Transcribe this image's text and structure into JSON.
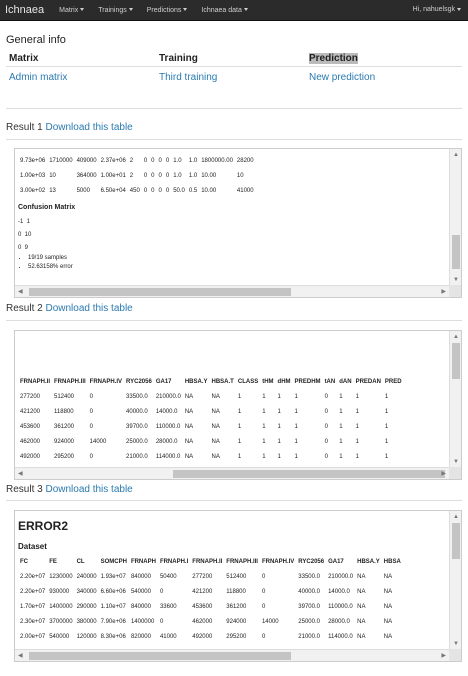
{
  "navbar": {
    "brand": "Ichnaea",
    "menus": [
      "Matrix",
      "Trainings",
      "Predictions",
      "Ichnaea data"
    ],
    "user": "Hi, nahuelsgk"
  },
  "general": {
    "title": "General info",
    "headers": [
      "Matrix",
      "Training",
      "Prediction"
    ],
    "links": [
      "Admin matrix",
      "Third training",
      "New prediction"
    ]
  },
  "results": [
    {
      "title": "Result 1",
      "link": "Download this table"
    },
    {
      "title": "Result 2",
      "link": "Download this table"
    },
    {
      "title": "Result 3",
      "link": "Download this table"
    }
  ],
  "result1": {
    "rows": [
      [
        "9.73e+06",
        "1710000",
        "409000",
        "2.37e+06",
        "2",
        "0",
        "0",
        "0",
        "0",
        "1.0",
        "1.0",
        "1800000.00",
        "28200"
      ],
      [
        "1.00e+03",
        "10",
        "364000",
        "1.00e+01",
        "2",
        "0",
        "0",
        "0",
        "0",
        "1.0",
        "1.0",
        "10.00",
        "10"
      ],
      [
        "3.00e+02",
        "13",
        "5000",
        "6.50e+04",
        "450",
        "0",
        "0",
        "0",
        "0",
        "50.0",
        "0.5",
        "10.00",
        "41000"
      ]
    ],
    "confusion_title": "Confusion Matrix",
    "confusion_lines": [
      "-1  1",
      "0  10",
      "0  9"
    ],
    "bullets": [
      "19/19 samples",
      "52.63158% error"
    ]
  },
  "result2": {
    "headers": [
      "FRNAPH.II",
      "FRNAPH.III",
      "FRNAPH.IV",
      "RYC2056",
      "GA17",
      "HBSA.Y",
      "HBSA.T",
      "CLASS",
      "tHM",
      "dHM",
      "PREDHM",
      "tAN",
      "dAN",
      "PREDAN",
      "PRED"
    ],
    "rows": [
      [
        "277200",
        "512400",
        "0",
        "33500.0",
        "210000.0",
        "NA",
        "NA",
        "1",
        "1",
        "1",
        "1",
        "0",
        "1",
        "1",
        "1"
      ],
      [
        "421200",
        "118800",
        "0",
        "40000.0",
        "14000.0",
        "NA",
        "NA",
        "1",
        "1",
        "1",
        "1",
        "0",
        "1",
        "1",
        "1"
      ],
      [
        "453600",
        "361200",
        "0",
        "39700.0",
        "110000.0",
        "NA",
        "NA",
        "1",
        "1",
        "1",
        "1",
        "0",
        "1",
        "1",
        "1"
      ],
      [
        "462000",
        "924000",
        "14000",
        "25000.0",
        "28000.0",
        "NA",
        "NA",
        "1",
        "1",
        "1",
        "1",
        "0",
        "1",
        "1",
        "1"
      ],
      [
        "492000",
        "295200",
        "0",
        "21000.0",
        "114000.0",
        "NA",
        "NA",
        "1",
        "1",
        "1",
        "1",
        "0",
        "1",
        "1",
        "1"
      ]
    ]
  },
  "result3": {
    "error_title": "ERROR2",
    "dataset_title": "Dataset",
    "headers": [
      "FC",
      "FE",
      "CL",
      "SOMCPH",
      "FRNAPH",
      "FRNAPH.I",
      "FRNAPH.II",
      "FRNAPH.III",
      "FRNAPH.IV",
      "RYC2056",
      "GA17",
      "HBSA.Y",
      "HBSA"
    ],
    "rows": [
      [
        "2.20e+07",
        "1230000",
        "240000",
        "1.93e+07",
        "840000",
        "50400",
        "277200",
        "512400",
        "0",
        "33500.0",
        "210000.0",
        "NA",
        "NA"
      ],
      [
        "2.20e+07",
        "930000",
        "340000",
        "6.60e+06",
        "540000",
        "0",
        "421200",
        "118800",
        "0",
        "40000.0",
        "14000.0",
        "NA",
        "NA"
      ],
      [
        "1.70e+07",
        "1400000",
        "290000",
        "1.10e+07",
        "840000",
        "33600",
        "453600",
        "361200",
        "0",
        "39700.0",
        "110000.0",
        "NA",
        "NA"
      ],
      [
        "2.30e+07",
        "3700000",
        "380000",
        "7.90e+06",
        "1400000",
        "0",
        "462000",
        "924000",
        "14000",
        "25000.0",
        "28000.0",
        "NA",
        "NA"
      ],
      [
        "2.00e+07",
        "540000",
        "120000",
        "8.30e+06",
        "820000",
        "41000",
        "492000",
        "295200",
        "0",
        "21000.0",
        "114000.0",
        "NA",
        "NA"
      ]
    ]
  }
}
